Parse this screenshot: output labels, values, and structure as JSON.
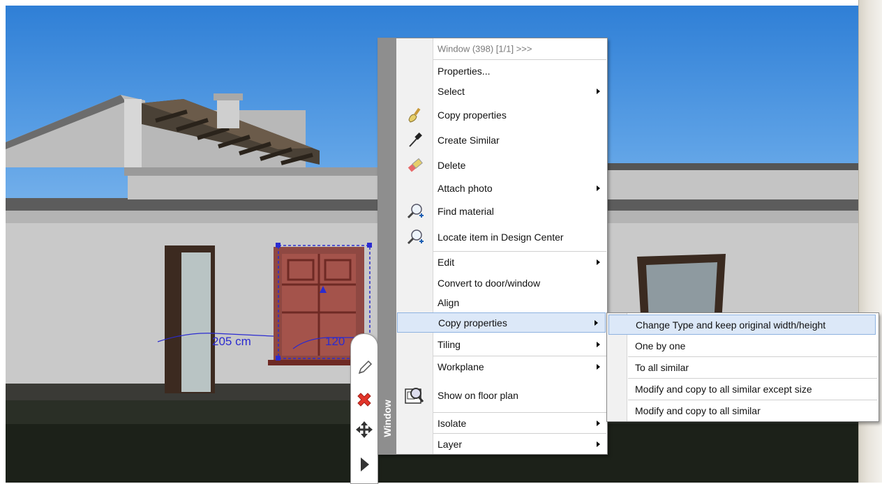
{
  "scene": {
    "selected_object": "Window",
    "dimension_width": "205 cm",
    "dimension_height": "120",
    "icons": [
      "vertex-handle-icon",
      "pencil-icon",
      "delete-x-icon",
      "move-arrows-icon",
      "expand-arrow-icon"
    ]
  },
  "context_menu": {
    "side_label": "Window",
    "header": "Window (398) [1/1] >>>",
    "items": [
      {
        "label": "Properties...",
        "icon": "",
        "submenu": false
      },
      {
        "label": "Select",
        "icon": "",
        "submenu": true
      },
      {
        "label": "Copy properties",
        "icon": "paint-brush-icon",
        "submenu": false
      },
      {
        "label": "Create Similar",
        "icon": "eyedropper-icon",
        "submenu": false
      },
      {
        "label": "Delete",
        "icon": "eraser-icon",
        "submenu": false
      },
      {
        "label": "Attach photo",
        "icon": "",
        "submenu": true
      },
      {
        "label": "Find material",
        "icon": "magnifier-plus-icon",
        "submenu": false
      },
      {
        "label": "Locate item in Design Center",
        "icon": "magnifier-plus-icon",
        "submenu": false
      },
      {
        "label": "Edit",
        "icon": "",
        "submenu": true
      },
      {
        "label": "Convert to door/window",
        "icon": "",
        "submenu": false
      },
      {
        "label": "Align",
        "icon": "",
        "submenu": false
      },
      {
        "label": "Copy properties",
        "icon": "",
        "submenu": true,
        "highlighted": true
      },
      {
        "label": "Tiling",
        "icon": "",
        "submenu": true
      },
      {
        "label": "Workplane",
        "icon": "",
        "submenu": true
      },
      {
        "label": "Show on floor plan",
        "icon": "floor-plan-search-icon",
        "submenu": false
      },
      {
        "label": "Isolate",
        "icon": "",
        "submenu": true
      },
      {
        "label": "Layer",
        "icon": "",
        "submenu": true
      }
    ]
  },
  "submenu": {
    "items": [
      {
        "label": "Change Type and keep original width/height",
        "highlighted": true
      },
      {
        "label": "One by one"
      },
      {
        "label": "To all similar"
      },
      {
        "label": "Modify and copy to all similar except size"
      },
      {
        "label": "Modify and copy to all similar"
      }
    ]
  },
  "colors": {
    "menu_highlight": "#dce8f8",
    "menu_highlight_border": "#8eb2e0",
    "menu_strip": "#8e8e8e",
    "selection": "#2b2bd0"
  }
}
